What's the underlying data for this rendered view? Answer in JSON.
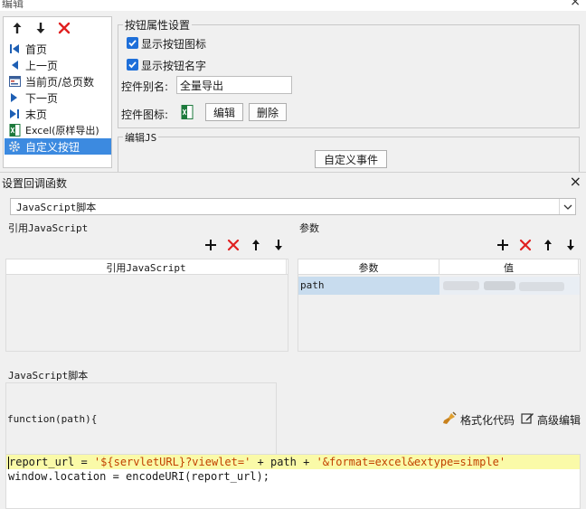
{
  "back_window": {
    "title": "编辑",
    "close_glyph": "×",
    "button_list": [
      {
        "label": "首页",
        "icon": "first-page-icon"
      },
      {
        "label": "上一页",
        "icon": "prev-page-icon"
      },
      {
        "label": "当前页/总页数",
        "icon": "page-count-icon"
      },
      {
        "label": "下一页",
        "icon": "next-page-icon"
      },
      {
        "label": "末页",
        "icon": "last-page-icon"
      },
      {
        "label": "Excel(原样导出)",
        "icon": "excel-icon"
      },
      {
        "label": "自定义按钮",
        "icon": "gear-icon",
        "selected": true
      }
    ],
    "props_group": {
      "legend": "按钮属性设置",
      "show_icon_label": "显示按钮图标",
      "show_icon_checked": true,
      "show_name_label": "显示按钮名字",
      "show_name_checked": true,
      "alias_label": "控件别名:",
      "alias_value": "全量导出",
      "icon_label": "控件图标:",
      "edit_button": "编辑",
      "delete_button": "删除"
    },
    "js_group": {
      "legend": "编辑JS",
      "custom_event_button": "自定义事件"
    }
  },
  "dialog": {
    "title": "设置回调函数",
    "close_glyph": "×",
    "type_select": {
      "value": "JavaScript脚本"
    },
    "ref_js": {
      "label": "引用JavaScript",
      "column_header": "引用JavaScript"
    },
    "params": {
      "label": "参数",
      "columns": [
        "参数",
        "值"
      ],
      "rows": [
        {
          "name": "path",
          "value": ""
        }
      ]
    },
    "script": {
      "label": "JavaScript脚本",
      "signature": "function(path){",
      "format_code": "格式化代码",
      "advanced_edit": "高级编辑",
      "code_lines": [
        {
          "plain1": "report_url = ",
          "str1": "'${servletURL}?viewlet='",
          "plain2": " + path + ",
          "str2": "'&format=excel&extype=simple'"
        },
        {
          "plain1": "window.location = encodeURI(report_url);"
        }
      ]
    }
  },
  "colors": {
    "accent_blue": "#1e6fd9",
    "delete_red": "#e02020",
    "selected_row": "#3c8ae0",
    "param_row": "#c8dcee",
    "code_highlight": "#fafaa8",
    "string_color": "#c24100"
  }
}
